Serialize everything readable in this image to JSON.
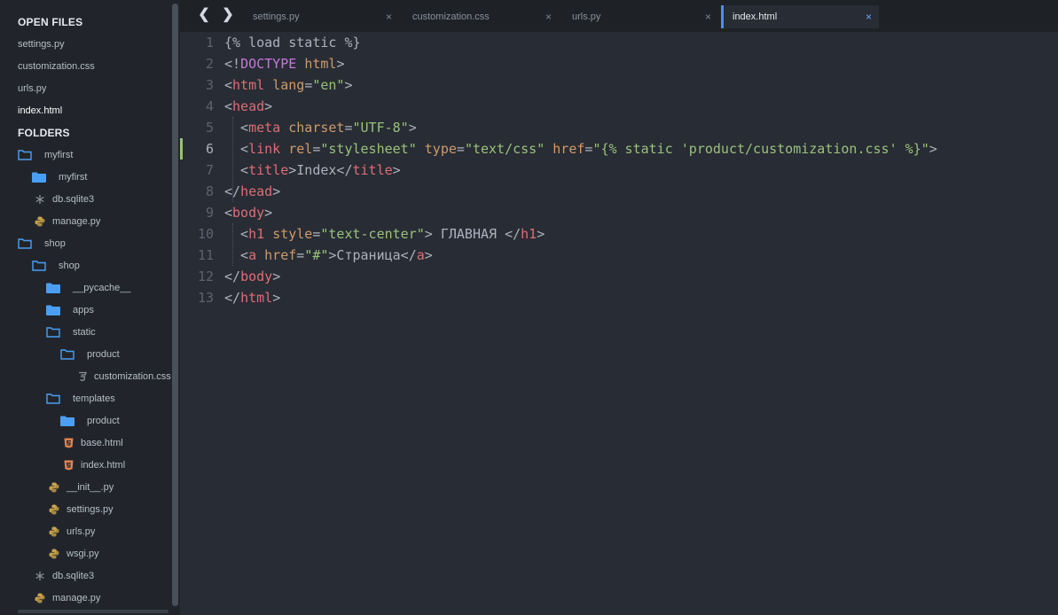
{
  "sidebar": {
    "open_files_title": "OPEN FILES",
    "open_files": [
      {
        "label": "settings.py",
        "active": false
      },
      {
        "label": "customization.css",
        "active": false
      },
      {
        "label": "urls.py",
        "active": false
      },
      {
        "label": "index.html",
        "active": true
      }
    ],
    "folders_title": "FOLDERS",
    "tree": [
      {
        "label": "myfirst",
        "icon": "folder-open",
        "depth": 0
      },
      {
        "label": "myfirst",
        "icon": "folder",
        "depth": 1
      },
      {
        "label": "db.sqlite3",
        "icon": "asterisk",
        "depth": 1
      },
      {
        "label": "manage.py",
        "icon": "python",
        "depth": 1
      },
      {
        "label": "shop",
        "icon": "folder-open",
        "depth": 0
      },
      {
        "label": "shop",
        "icon": "folder-open",
        "depth": 1
      },
      {
        "label": "__pycache__",
        "icon": "folder",
        "depth": 2
      },
      {
        "label": "apps",
        "icon": "folder",
        "depth": 2
      },
      {
        "label": "static",
        "icon": "folder-open",
        "depth": 2
      },
      {
        "label": "product",
        "icon": "folder-open",
        "depth": 3
      },
      {
        "label": "customization.css",
        "icon": "css",
        "depth": 4
      },
      {
        "label": "templates",
        "icon": "folder-open",
        "depth": 2
      },
      {
        "label": "product",
        "icon": "folder",
        "depth": 3
      },
      {
        "label": "base.html",
        "icon": "html5",
        "depth": 3
      },
      {
        "label": "index.html",
        "icon": "html5",
        "depth": 3
      },
      {
        "label": "__init__.py",
        "icon": "python",
        "depth": 2
      },
      {
        "label": "settings.py",
        "icon": "python",
        "depth": 2
      },
      {
        "label": "urls.py",
        "icon": "python",
        "depth": 2
      },
      {
        "label": "wsgi.py",
        "icon": "python",
        "depth": 2
      },
      {
        "label": "db.sqlite3",
        "icon": "asterisk",
        "depth": 1
      },
      {
        "label": "manage.py",
        "icon": "python",
        "depth": 1
      }
    ]
  },
  "tabs": [
    {
      "label": "settings.py",
      "close": "×",
      "active": false
    },
    {
      "label": "customization.css",
      "close": "×",
      "active": false
    },
    {
      "label": "urls.py",
      "close": "×",
      "active": false
    },
    {
      "label": "index.html",
      "close": "×",
      "active": true
    }
  ],
  "nav": {
    "back": "❮",
    "forward": "❯"
  },
  "editor": {
    "current_line": 6,
    "lines": [
      {
        "n": "1",
        "tokens": [
          [
            "txt",
            "{% load static %}"
          ]
        ]
      },
      {
        "n": "2",
        "tokens": [
          [
            "txt",
            "<!"
          ],
          [
            "doc",
            "DOCTYPE"
          ],
          [
            "txt",
            " "
          ],
          [
            "attr",
            "html"
          ],
          [
            "txt",
            ">"
          ]
        ]
      },
      {
        "n": "3",
        "tokens": [
          [
            "txt",
            "<"
          ],
          [
            "tag",
            "html"
          ],
          [
            "txt",
            " "
          ],
          [
            "attr",
            "lang"
          ],
          [
            "txt",
            "="
          ],
          [
            "str",
            "\"en\""
          ],
          [
            "txt",
            ">"
          ]
        ]
      },
      {
        "n": "4",
        "tokens": [
          [
            "txt",
            "<"
          ],
          [
            "tag",
            "head"
          ],
          [
            "txt",
            ">"
          ]
        ]
      },
      {
        "n": "5",
        "tokens": [
          [
            "txt",
            "  <"
          ],
          [
            "tag",
            "meta"
          ],
          [
            "txt",
            " "
          ],
          [
            "attr",
            "charset"
          ],
          [
            "txt",
            "="
          ],
          [
            "str",
            "\"UTF-8\""
          ],
          [
            "txt",
            ">"
          ]
        ]
      },
      {
        "n": "6",
        "tokens": [
          [
            "txt",
            "  <"
          ],
          [
            "tag",
            "link"
          ],
          [
            "txt",
            " "
          ],
          [
            "attr",
            "rel"
          ],
          [
            "txt",
            "="
          ],
          [
            "str",
            "\"stylesheet\""
          ],
          [
            "txt",
            " "
          ],
          [
            "attr",
            "type"
          ],
          [
            "txt",
            "="
          ],
          [
            "str",
            "\"text/css\""
          ],
          [
            "txt",
            " "
          ],
          [
            "attr",
            "href"
          ],
          [
            "txt",
            "="
          ],
          [
            "str",
            "\"{% static 'product/customization.css' %}\""
          ],
          [
            "txt",
            ">"
          ]
        ]
      },
      {
        "n": "7",
        "tokens": [
          [
            "txt",
            "  <"
          ],
          [
            "tag",
            "title"
          ],
          [
            "txt",
            ">Index</"
          ],
          [
            "tag",
            "title"
          ],
          [
            "txt",
            ">"
          ]
        ]
      },
      {
        "n": "8",
        "tokens": [
          [
            "txt",
            "</"
          ],
          [
            "tag",
            "head"
          ],
          [
            "txt",
            ">"
          ]
        ]
      },
      {
        "n": "9",
        "tokens": [
          [
            "txt",
            "<"
          ],
          [
            "tag",
            "body"
          ],
          [
            "txt",
            ">"
          ]
        ]
      },
      {
        "n": "10",
        "tokens": [
          [
            "txt",
            "  <"
          ],
          [
            "tag",
            "h1"
          ],
          [
            "txt",
            " "
          ],
          [
            "attr",
            "style"
          ],
          [
            "txt",
            "="
          ],
          [
            "str",
            "\"text-center\""
          ],
          [
            "txt",
            "> ГЛАВНАЯ </"
          ],
          [
            "tag",
            "h1"
          ],
          [
            "txt",
            ">"
          ]
        ]
      },
      {
        "n": "11",
        "tokens": [
          [
            "txt",
            "  <"
          ],
          [
            "tag",
            "a"
          ],
          [
            "txt",
            " "
          ],
          [
            "attr",
            "href"
          ],
          [
            "txt",
            "="
          ],
          [
            "str",
            "\"#\""
          ],
          [
            "txt",
            ">Страница</"
          ],
          [
            "tag",
            "a"
          ],
          [
            "txt",
            ">"
          ]
        ]
      },
      {
        "n": "12",
        "tokens": [
          [
            "txt",
            "</"
          ],
          [
            "tag",
            "body"
          ],
          [
            "txt",
            ">"
          ]
        ]
      },
      {
        "n": "13",
        "tokens": [
          [
            "txt",
            "</"
          ],
          [
            "tag",
            "html"
          ],
          [
            "txt",
            ">"
          ]
        ]
      }
    ]
  },
  "colors": {
    "accent": "#528bff",
    "tag": "#e06c75",
    "attribute": "#d19a66",
    "string": "#98c379",
    "doctype": "#c678dd",
    "folder": "#4a9ff5",
    "html_icon": "#e0834f",
    "python_icon": "#c9a24c"
  }
}
